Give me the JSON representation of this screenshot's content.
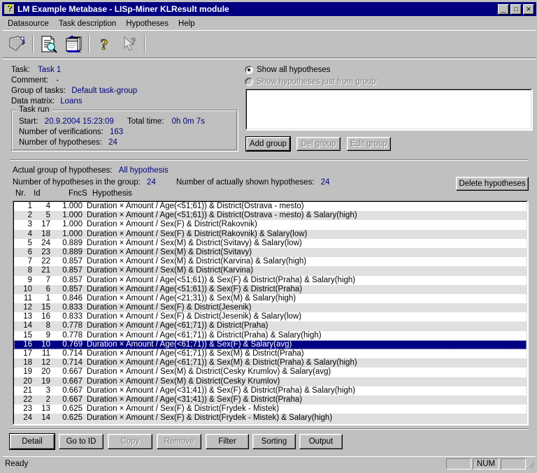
{
  "window": {
    "title": "LM Example Metabase - LISp-Miner KLResult module",
    "app_icon": "question-mark-icon",
    "minimize_label": "_",
    "maximize_label": "□",
    "close_label": "✕",
    "titlebar_color": "#000080",
    "face_color": "#c0c0c0"
  },
  "menu": {
    "items": [
      {
        "label": "Datasource",
        "accel": "s"
      },
      {
        "label": "Task description",
        "accel": "T"
      },
      {
        "label": "Hypotheses",
        "accel": "H"
      },
      {
        "label": "Help",
        "accel": "H"
      }
    ]
  },
  "toolbar": {
    "buttons": [
      {
        "name": "data-matrix-icon",
        "tooltip": "Data matrix"
      },
      {
        "name": "task-description-icon",
        "tooltip": "Task description"
      },
      {
        "name": "hypotheses-cardfile-icon",
        "tooltip": "Hypotheses"
      },
      {
        "name": "help-icon",
        "tooltip": "Help"
      },
      {
        "name": "context-help-icon",
        "tooltip": "Context help"
      }
    ]
  },
  "task_info": {
    "task_label": "Task:",
    "task_value": "Task 1",
    "comment_label": "Comment:",
    "comment_value": "-",
    "group_label": "Group of tasks:",
    "group_value": "Default task-group",
    "matrix_label": "Data matrix:",
    "matrix_value": "Loans"
  },
  "task_run": {
    "legend": "Task run",
    "start_label": "Start:",
    "start_value": "20.9.2004 15:23:09",
    "total_time_label": "Total time:",
    "total_time_value": "0h 0m 7s",
    "verifications_label": "Number of verifications:",
    "verifications_value": "163",
    "hypotheses_label": "Number of hypotheses:",
    "hypotheses_value": "24"
  },
  "group_filter": {
    "radio_all_label": "Show all hypotheses",
    "radio_all_accel": "w",
    "radio_group_label": "Show hypotheses just from group:",
    "radio_group_accel": "g",
    "selected": "all",
    "list_items": [],
    "add_group_label": "Add group",
    "del_group_label": "Del group",
    "edit_group_label": "Edit group",
    "del_group_enabled": false,
    "edit_group_enabled": false
  },
  "actual_group": {
    "label": "Actual group of hypotheses:",
    "value": "All hypothesis",
    "count_in_group_label": "Number of hypotheses in the group:",
    "count_in_group_value": "24",
    "count_shown_label": "Number of actually shown hypotheses:",
    "count_shown_value": "24",
    "delete_hypotheses_label": "Delete hypotheses"
  },
  "list": {
    "columns": [
      "Nr.",
      "Id",
      "FncS",
      "Hypothesis"
    ],
    "selected_index": 15,
    "rows": [
      {
        "nr": "1",
        "id": "4",
        "fncs": "1.000",
        "hypothesis": "Duration × Amount / Age(<51;61)) & District(Ostrava - mesto)"
      },
      {
        "nr": "2",
        "id": "5",
        "fncs": "1.000",
        "hypothesis": "Duration × Amount / Age(<51;61)) & District(Ostrava - mesto) & Salary(high)"
      },
      {
        "nr": "3",
        "id": "17",
        "fncs": "1.000",
        "hypothesis": "Duration × Amount / Sex(F) & District(Rakovnik)"
      },
      {
        "nr": "4",
        "id": "18",
        "fncs": "1.000",
        "hypothesis": "Duration × Amount / Sex(F) & District(Rakovnik) & Salary(low)"
      },
      {
        "nr": "5",
        "id": "24",
        "fncs": "0.889",
        "hypothesis": "Duration × Amount / Sex(M) & District(Svitavy) & Salary(low)"
      },
      {
        "nr": "6",
        "id": "23",
        "fncs": "0.889",
        "hypothesis": "Duration × Amount / Sex(M) & District(Svitavy)"
      },
      {
        "nr": "7",
        "id": "22",
        "fncs": "0.857",
        "hypothesis": "Duration × Amount / Sex(M) & District(Karvina) & Salary(high)"
      },
      {
        "nr": "8",
        "id": "21",
        "fncs": "0.857",
        "hypothesis": "Duration × Amount / Sex(M) & District(Karvina)"
      },
      {
        "nr": "9",
        "id": "7",
        "fncs": "0.857",
        "hypothesis": "Duration × Amount / Age(<51;61)) & Sex(F) & District(Praha) & Salary(high)"
      },
      {
        "nr": "10",
        "id": "6",
        "fncs": "0.857",
        "hypothesis": "Duration × Amount / Age(<51;61)) & Sex(F) & District(Praha)"
      },
      {
        "nr": "11",
        "id": "1",
        "fncs": "0.846",
        "hypothesis": "Duration × Amount / Age(<21;31)) & Sex(M) & Salary(high)"
      },
      {
        "nr": "12",
        "id": "15",
        "fncs": "0.833",
        "hypothesis": "Duration × Amount / Sex(F) & District(Jesenik)"
      },
      {
        "nr": "13",
        "id": "16",
        "fncs": "0.833",
        "hypothesis": "Duration × Amount / Sex(F) & District(Jesenik) & Salary(low)"
      },
      {
        "nr": "14",
        "id": "8",
        "fncs": "0.778",
        "hypothesis": "Duration × Amount / Age(<61;71)) & District(Praha)"
      },
      {
        "nr": "15",
        "id": "9",
        "fncs": "0.778",
        "hypothesis": "Duration × Amount / Age(<61;71)) & District(Praha) & Salary(high)"
      },
      {
        "nr": "16",
        "id": "10",
        "fncs": "0.769",
        "hypothesis": "Duration × Amount / Age(<61;71)) & Sex(F) & Salary(avg)"
      },
      {
        "nr": "17",
        "id": "11",
        "fncs": "0.714",
        "hypothesis": "Duration × Amount / Age(<61;71)) & Sex(M) & District(Praha)"
      },
      {
        "nr": "18",
        "id": "12",
        "fncs": "0.714",
        "hypothesis": "Duration × Amount / Age(<61;71)) & Sex(M) & District(Praha) & Salary(high)"
      },
      {
        "nr": "19",
        "id": "20",
        "fncs": "0.667",
        "hypothesis": "Duration × Amount / Sex(M) & District(Cesky Krumlov) & Salary(avg)"
      },
      {
        "nr": "20",
        "id": "19",
        "fncs": "0.667",
        "hypothesis": "Duration × Amount / Sex(M) & District(Cesky Krumlov)"
      },
      {
        "nr": "21",
        "id": "3",
        "fncs": "0.667",
        "hypothesis": "Duration × Amount / Age(<31;41)) & Sex(F) & District(Praha) & Salary(high)"
      },
      {
        "nr": "22",
        "id": "2",
        "fncs": "0.667",
        "hypothesis": "Duration × Amount / Age(<31;41)) & Sex(F) & District(Praha)"
      },
      {
        "nr": "23",
        "id": "13",
        "fncs": "0.625",
        "hypothesis": "Duration × Amount / Sex(F) & District(Frydek - Mistek)"
      },
      {
        "nr": "24",
        "id": "14",
        "fncs": "0.625",
        "hypothesis": "Duration × Amount / Sex(F) & District(Frydek - Mistek) & Salary(high)"
      }
    ]
  },
  "bottom_buttons": [
    {
      "label": "Detail",
      "accel": "e",
      "enabled": true,
      "default": true,
      "name": "detail-button"
    },
    {
      "label": "Go to ID",
      "accel": "G",
      "enabled": true,
      "default": false,
      "name": "go-to-id-button"
    },
    {
      "label": "Copy",
      "accel": "C",
      "enabled": false,
      "default": false,
      "name": "copy-button"
    },
    {
      "label": "Remove",
      "accel": "R",
      "enabled": false,
      "default": false,
      "name": "remove-button"
    },
    {
      "label": "Filter",
      "accel": "F",
      "enabled": true,
      "default": false,
      "name": "filter-button"
    },
    {
      "label": "Sorting",
      "accel": "n",
      "enabled": true,
      "default": false,
      "name": "sorting-button"
    },
    {
      "label": "Output",
      "accel": "O",
      "enabled": true,
      "default": false,
      "name": "output-button"
    }
  ],
  "statusbar": {
    "message": "Ready",
    "panel1": "",
    "panel_num": "NUM",
    "panel3": ""
  }
}
